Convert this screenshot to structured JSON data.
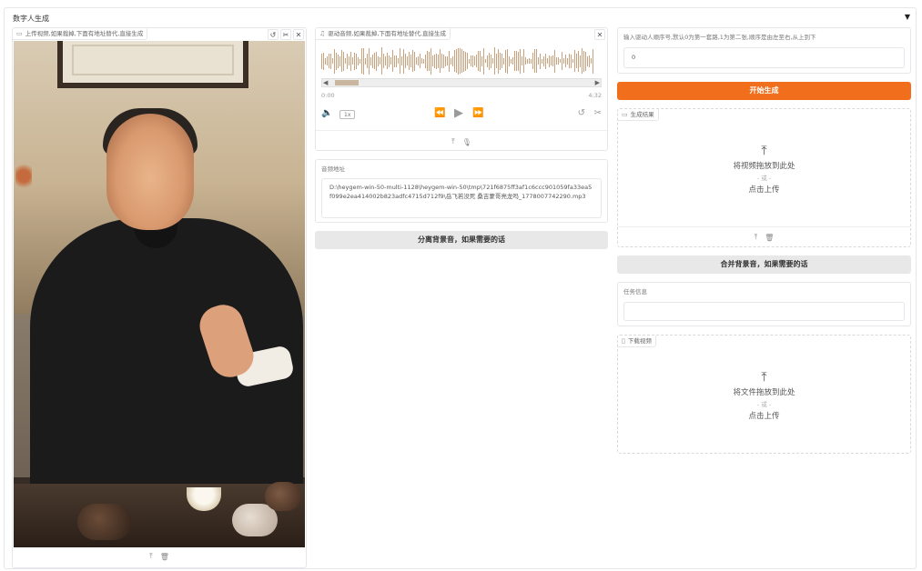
{
  "accordion": {
    "title": "数字人生成",
    "toggle_glyph": "▼"
  },
  "video_input": {
    "label": "上传视频,如果裁掉,下面有地址替代,直接生成",
    "label_icon": "video-icon",
    "undo_glyph": "↺",
    "edit_glyph": "✂",
    "close_glyph": "✕",
    "bottom_glyphs": [
      "⤒",
      "🗑"
    ]
  },
  "audio_input": {
    "label": "驱动音频,如果裁掉,下面有地址替代,直接生成",
    "label_icon": "music-icon",
    "close_glyph": "✕",
    "time_start": "0:00",
    "time_end": "4:32",
    "speed": "1x",
    "glyphs": {
      "volume": "🔈",
      "rewind": "⏪",
      "play": "▶",
      "forward": "⏩",
      "undo": "↺",
      "trim": "✂",
      "upload": "⤒",
      "mic": "🎙",
      "left": "◀",
      "right": "▶"
    }
  },
  "audio_path": {
    "label": "音频地址",
    "value": "D:\\heygem-win-50-multi-1128\\heygem-win-50\\tmp\\721f6875ff3af1c6ccc901059fa33ea5f099e2ea414002b823adfc4715d712f9\\岳飞若没死 桑吉蒙哥亮龙吗_1778007742290.mp3"
  },
  "separate_bg_button": {
    "label": "分离背景音，如果需要的话"
  },
  "driver_order": {
    "label": "输入驱动人顺序号,默认0为第一套路,1为第二张,顺序是由左至右,从上到下",
    "value": "0"
  },
  "start_button": {
    "label": "开始生成"
  },
  "result_video": {
    "label": "生成结果",
    "label_icon": "video-icon",
    "upload_main": "将视频拖放到此处",
    "upload_or": "- 或 -",
    "upload_click": "点击上传",
    "bottom_glyphs": [
      "⤒",
      "🗑"
    ]
  },
  "merge_bg_button": {
    "label": "合并背景音，如果需要的话"
  },
  "task_info": {
    "label": "任务信息",
    "value": ""
  },
  "download_video": {
    "label": "下载视频",
    "label_icon": "file-icon",
    "upload_main": "将文件拖放到此处",
    "upload_or": "- 或 -",
    "upload_click": "点击上传"
  },
  "colors": {
    "accent": "#f06e1c",
    "waveform": "#c9a380"
  }
}
